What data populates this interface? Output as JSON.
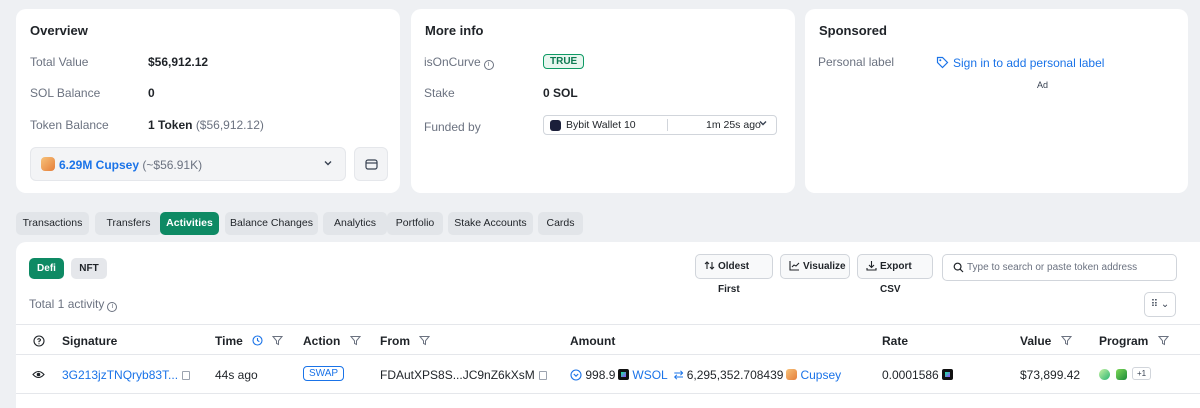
{
  "overview": {
    "title": "Overview",
    "total_value_label": "Total Value",
    "total_value": "$56,912.12",
    "sol_balance_label": "SOL Balance",
    "sol_balance": "0",
    "token_balance_label": "Token Balance",
    "token_balance": "1 Token",
    "token_balance_usd": "($56,912.12)",
    "token_select_main": "6.29M Cupsey",
    "token_select_sub": "(~$56.91K)"
  },
  "more_info": {
    "title": "More info",
    "is_on_curve_label": "isOnCurve",
    "is_on_curve_value": "TRUE",
    "stake_label": "Stake",
    "stake_value": "0 SOL",
    "funded_by_label": "Funded by",
    "funder_name": "Bybit Wallet 10",
    "funder_time": "1m 25s ago"
  },
  "sponsored": {
    "title": "Sponsored",
    "personal_label": "Personal label",
    "sign_in_link": "Sign in to add personal label",
    "ad_label": "Ad"
  },
  "tabs": [
    "Transactions",
    "Transfers",
    "Activities",
    "Balance Changes",
    "Analytics",
    "Portfolio",
    "Stake Accounts",
    "Cards"
  ],
  "active_tab": "Activities",
  "subtabs": [
    "Defi",
    "NFT"
  ],
  "toolbar": {
    "oldest_first": "Oldest First",
    "visualize": "Visualize",
    "export_csv": "Export CSV",
    "search_placeholder": "Type to search or paste token address"
  },
  "total_activity": "Total 1 activity",
  "table": {
    "headers": {
      "signature": "Signature",
      "time": "Time",
      "action": "Action",
      "from": "From",
      "amount": "Amount",
      "rate": "Rate",
      "value": "Value",
      "program": "Program"
    },
    "rows": [
      {
        "signature": "3G213jzTNQryb83T...",
        "time": "44s ago",
        "action": "SWAP",
        "from": "FDAutXPS8S...JC9nZ6kXsM",
        "amount_in": "998.9",
        "token_in": "WSOL",
        "amount_out": "6,295,352.708439",
        "token_out": "Cupsey",
        "rate": "0.0001586",
        "value": "$73,899.42",
        "program_more": "+1"
      }
    ]
  },
  "colors": {
    "accent": "#0e8a64",
    "link": "#1a73e8",
    "background": "#eef0f3"
  }
}
